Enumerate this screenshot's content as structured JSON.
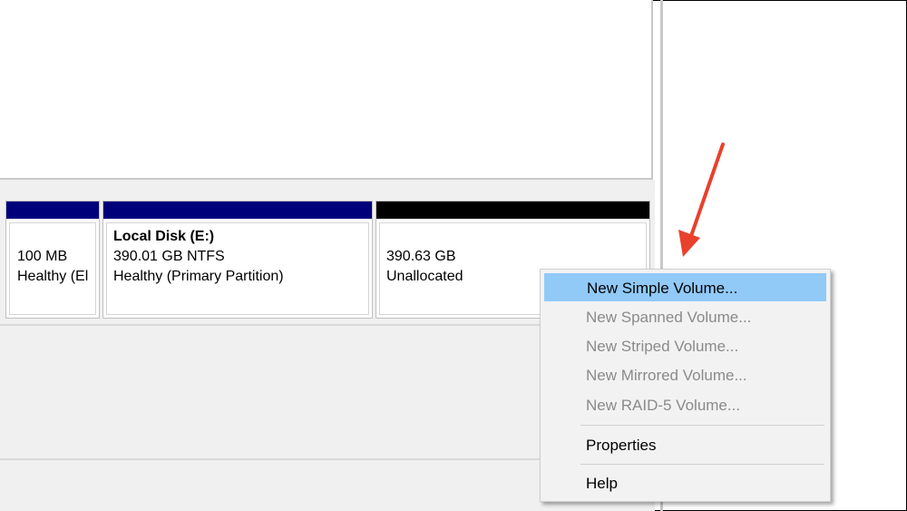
{
  "partitions": [
    {
      "size": "100 MB",
      "status": "Healthy (El"
    },
    {
      "name": "Local Disk  (E:)",
      "size": "390.01 GB NTFS",
      "status": "Healthy (Primary Partition)"
    },
    {
      "size": "390.63 GB",
      "status": "Unallocated"
    }
  ],
  "context_menu": {
    "items": [
      {
        "label": "New Simple Volume...",
        "enabled": true,
        "highlighted": true
      },
      {
        "label": "New Spanned Volume...",
        "enabled": false
      },
      {
        "label": "New Striped Volume...",
        "enabled": false
      },
      {
        "label": "New Mirrored Volume...",
        "enabled": false
      },
      {
        "label": "New RAID-5 Volume...",
        "enabled": false
      },
      {
        "label": "Properties",
        "enabled": true
      },
      {
        "label": "Help",
        "enabled": true
      }
    ]
  },
  "colors": {
    "partition_bar": "#00007b",
    "unallocated_bar": "#000000",
    "menu_highlight": "#91c9f7",
    "annotation_arrow": "#e8412c"
  },
  "annotation": {
    "icon": "red-arrow-icon"
  }
}
